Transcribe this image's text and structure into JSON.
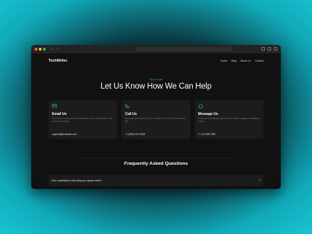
{
  "colors": {
    "accent": "#2bb8b0",
    "background": "#111111",
    "card": "#1c1c1c"
  },
  "browser": {
    "traffic_lights": [
      "#ff5f57",
      "#febc2e",
      "#28c840"
    ]
  },
  "site": {
    "logo": "TechWriter.",
    "nav": [
      "Home",
      "Blog",
      "About Us",
      "Contact"
    ]
  },
  "hero": {
    "tag": "Get in Touch",
    "title": "Let Us Know How We Can Help"
  },
  "cards": [
    {
      "icon": "mail-icon",
      "title": "Email Us",
      "desc": "Let us know how we can help with a quick email - we'll get back to you as soon as possible.",
      "contact": "support@techwriter.com"
    },
    {
      "icon": "phone-icon",
      "title": "Call Us",
      "desc": "We would love to hear from you. Our team is on Mon to Fri from 8am to 5pm.",
      "contact": "+1 (098) 123-12349"
    },
    {
      "icon": "whatsapp-icon",
      "title": "Message Us",
      "desc": "Simply tap the whatsapp right? Send us a quick message on WhatsApp instead.",
      "contact": "+1 123 456 7899"
    }
  ],
  "faq": {
    "title": "Frequently Asked Questions",
    "items": [
      {
        "question": "Can I contribute to this blog as a guest writer?"
      }
    ]
  }
}
